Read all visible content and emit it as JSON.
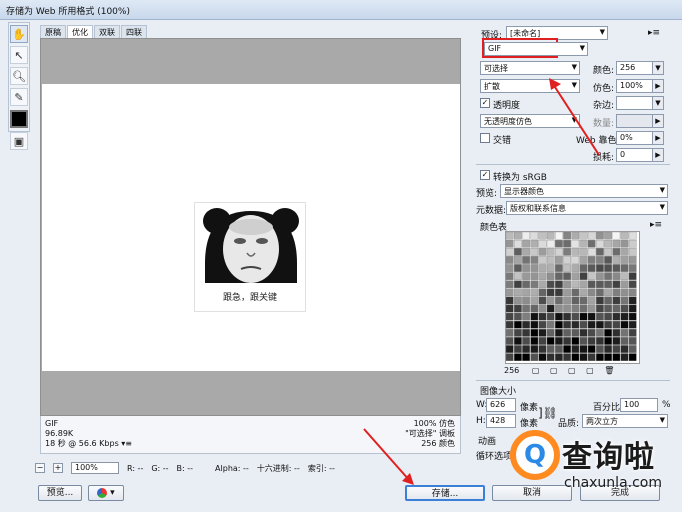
{
  "window": {
    "title": "存储为 Web 所用格式 (100%)"
  },
  "tabs": [
    {
      "label": "原稿",
      "active": false
    },
    {
      "label": "优化",
      "active": true
    },
    {
      "label": "双联",
      "active": false
    },
    {
      "label": "四联",
      "active": false
    }
  ],
  "preview": {
    "caption": "跟急，跟关键",
    "format": "GIF",
    "size": "96.89K",
    "speed": "18 秒 @ 56.6 Kbps",
    "dither_info": "100% 仿色",
    "palette_info": "\"可选择\" 调板",
    "color_info": "256 颜色"
  },
  "statusbar": {
    "zoom": "100%",
    "r": "R: --",
    "g": "G: --",
    "b": "B: --",
    "alpha": "Alpha: --",
    "hex": "十六进制: --",
    "index": "索引: --"
  },
  "buttons": {
    "preview": "预览...",
    "save": "存储...",
    "cancel": "取消",
    "done": "完成"
  },
  "settings": {
    "preset_label": "预设:",
    "preset_value": "[未命名]",
    "format": "GIF",
    "color_reduction": "可选择",
    "dither_method": "扩散",
    "transparency_label": "透明度",
    "transparency_checked": true,
    "transparency_dither": "无透明度仿色",
    "interlaced_label": "交错",
    "interlaced_checked": false,
    "colors_label": "颜色:",
    "colors_value": "256",
    "dither_label": "仿色:",
    "dither_value": "100%",
    "matte_label": "杂边:",
    "amount_label": "数量:",
    "web_snap_label": "Web 靠色:",
    "web_snap_value": "0%",
    "lossy_label": "损耗:",
    "lossy_value": "0",
    "convert_srgb_label": "转换为 sRGB",
    "convert_srgb_checked": true,
    "preview_label": "预览:",
    "preview_value": "显示器颜色",
    "metadata_label": "元数据:",
    "metadata_value": "版权和联系信息",
    "color_table_label": "颜色表",
    "color_count": "256"
  },
  "image_size": {
    "title": "图像大小",
    "width_label": "W:",
    "width_value": "626",
    "height_label": "H:",
    "height_value": "428",
    "unit": "像素",
    "percent_label": "百分比:",
    "percent_value": "100",
    "percent_unit": "%",
    "quality_label": "品质:",
    "quality_value": "两次立方",
    "animation_label": "动画",
    "loop_label": "循环选项"
  },
  "watermark": {
    "logo_glyph": "Q",
    "brand": "查询啦",
    "url": "chaxunla.com"
  },
  "accent": {
    "highlight": "#e02020",
    "watermark_orange": "#ff8a1f",
    "watermark_blue": "#2b8ae6"
  }
}
